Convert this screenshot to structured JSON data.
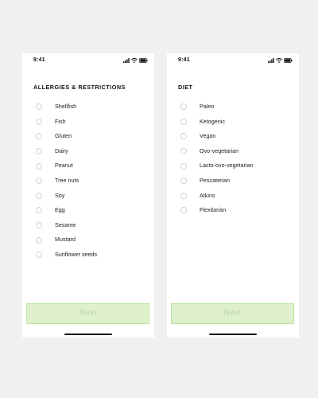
{
  "screens": [
    {
      "status_time": "9:41",
      "title": "ALLERGIES & RESTRICTIONS",
      "options": [
        {
          "label": "Shellfish"
        },
        {
          "label": "Fish"
        },
        {
          "label": "Gluten"
        },
        {
          "label": "Dairy"
        },
        {
          "label": "Peanut"
        },
        {
          "label": "Tree nuts"
        },
        {
          "label": "Soy"
        },
        {
          "label": "Egg"
        },
        {
          "label": "Sesame"
        },
        {
          "label": "Mustard"
        },
        {
          "label": "Sunflower seeds"
        }
      ],
      "next_label": "Next"
    },
    {
      "status_time": "9:41",
      "title": "DIET",
      "options": [
        {
          "label": "Paleo"
        },
        {
          "label": "Ketogenic"
        },
        {
          "label": "Vegan"
        },
        {
          "label": "Ovo-vegetarian"
        },
        {
          "label": "Lacto-ovo-vegetarian"
        },
        {
          "label": "Pescaterian"
        },
        {
          "label": "Atkins"
        },
        {
          "label": "Flexitarian"
        }
      ],
      "next_label": "Next"
    }
  ],
  "icons": {
    "signal": "signal-icon",
    "wifi": "wifi-icon",
    "battery": "battery-icon"
  },
  "colors": {
    "background": "#eef0f2",
    "screen": "#ffffff",
    "button_fill": "#def0cc",
    "button_border": "#bde3a0",
    "button_text": "#bcd7a4",
    "radio_border": "#cfd3d6"
  }
}
